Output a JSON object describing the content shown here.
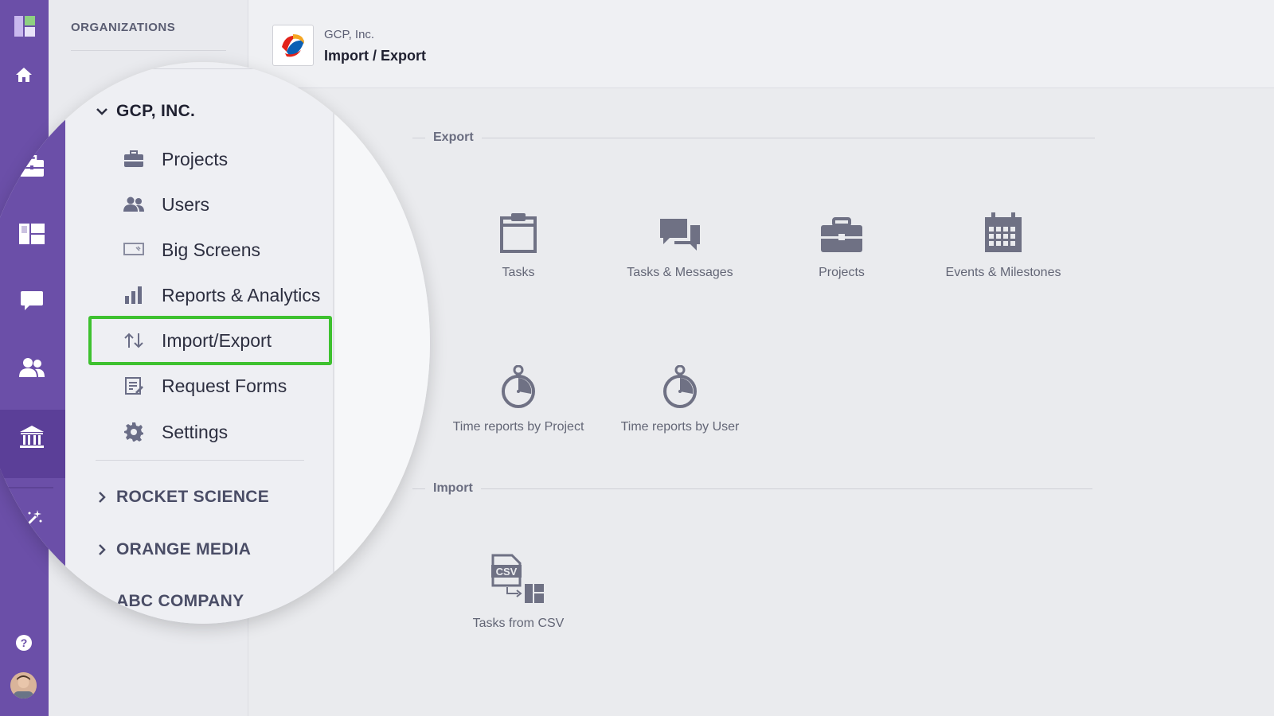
{
  "org_panel": {
    "heading": "ORGANIZATIONS"
  },
  "header": {
    "breadcrumb": "GCP, Inc.",
    "title": "Import / Export"
  },
  "sidebar_nav": {
    "expanded_org": "GCP, INC.",
    "items": [
      {
        "label": "Projects",
        "icon": "briefcase-icon"
      },
      {
        "label": "Users",
        "icon": "users-icon"
      },
      {
        "label": "Big Screens",
        "icon": "big-screen-icon"
      },
      {
        "label": "Reports & Analytics",
        "icon": "bar-chart-icon"
      },
      {
        "label": "Import/Export",
        "icon": "import-export-icon",
        "active": true
      },
      {
        "label": "Request Forms",
        "icon": "form-icon"
      },
      {
        "label": "Settings",
        "icon": "gear-icon"
      }
    ],
    "other_orgs": [
      "ROCKET SCIENCE",
      "ORANGE MEDIA",
      "ABC COMPANY"
    ]
  },
  "export": {
    "title": "Export",
    "tiles": [
      {
        "label": "Tasks",
        "icon": "clipboard-icon"
      },
      {
        "label": "Tasks & Messages",
        "icon": "chat-bubbles-icon"
      },
      {
        "label": "Projects",
        "icon": "briefcase-icon"
      },
      {
        "label": "Events & Milestones",
        "icon": "calendar-icon"
      },
      {
        "label": "Time reports by Project",
        "icon": "stopwatch-icon"
      },
      {
        "label": "Time reports by User",
        "icon": "stopwatch-icon"
      }
    ]
  },
  "import": {
    "title": "Import",
    "tiles": [
      {
        "label": "Tasks from CSV",
        "icon": "csv-import-icon",
        "badge": "CSV"
      }
    ]
  },
  "colors": {
    "rail": "#6b4fa8",
    "highlight": "#3ec12f",
    "icon_gray": "#6f7184"
  }
}
